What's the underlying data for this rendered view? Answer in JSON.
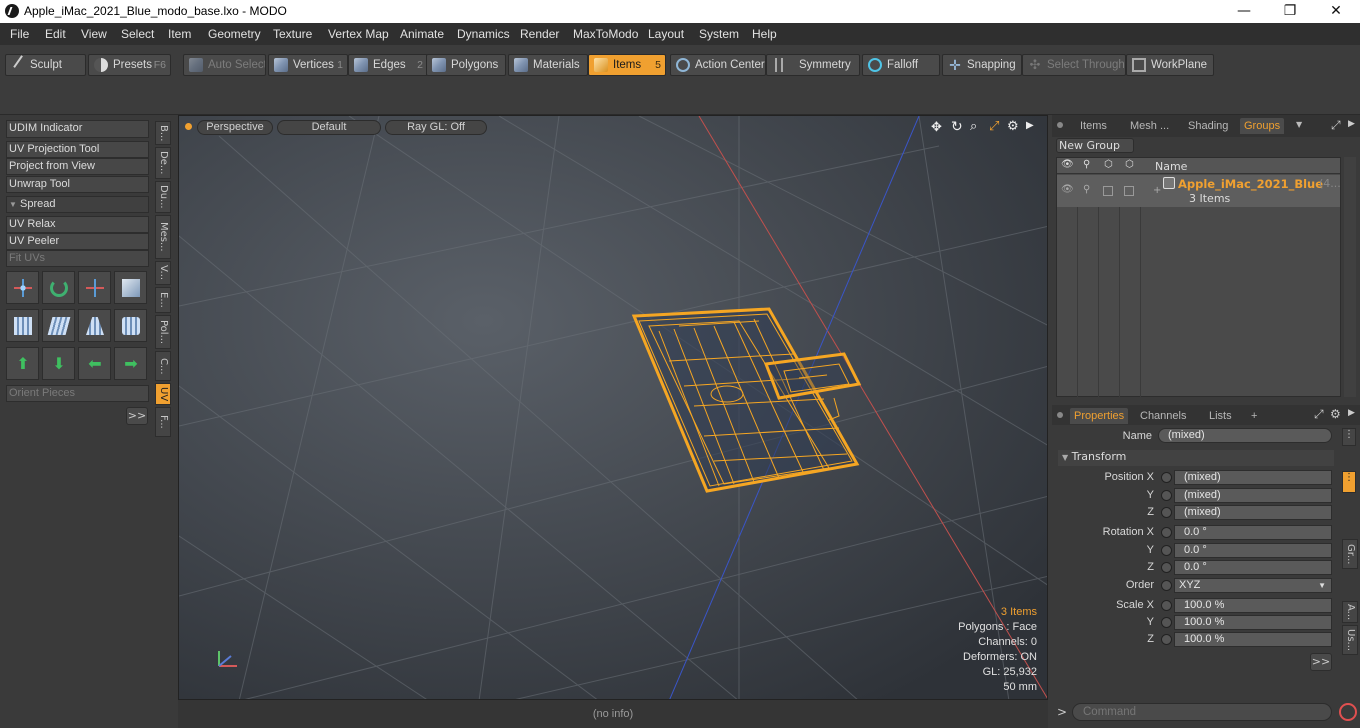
{
  "window": {
    "title": "Apple_iMac_2021_Blue_modo_base.lxo - MODO",
    "minimize": "—",
    "maximize": "❐",
    "close": "✕"
  },
  "menu": [
    "File",
    "Edit",
    "View",
    "Select",
    "Item",
    "Geometry",
    "Texture",
    "Vertex Map",
    "Animate",
    "Dynamics",
    "Render",
    "MaxToModo",
    "Layout",
    "System",
    "Help"
  ],
  "toolbar": {
    "sculpt": "Sculpt",
    "presets": "Presets",
    "presets_key": "F6",
    "auto_select": "Auto Select",
    "vertices": "Vertices",
    "vertices_key": "1",
    "edges": "Edges",
    "edges_key": "2",
    "polygons": "Polygons",
    "materials": "Materials",
    "items": "Items",
    "items_key": "5",
    "action_center": "Action Center",
    "symmetry": "Symmetry",
    "falloff": "Falloff",
    "snapping": "Snapping",
    "select_through": "Select Through",
    "workplane": "WorkPlane"
  },
  "left": {
    "udim": "UDIM Indicator",
    "uv_projection": "UV Projection Tool",
    "project_from_view": "Project from View",
    "unwrap": "Unwrap Tool",
    "spread": "Spread",
    "uv_relax": "UV Relax",
    "uv_peeler": "UV Peeler",
    "fit_uvs": "Fit UVs",
    "orient_pieces": "Orient Pieces",
    "more": ">>",
    "vtabs": [
      "B...",
      "De...",
      "Du...",
      "Mes...",
      "V...",
      "E...",
      "Pol...",
      "C...",
      "UV",
      "F..."
    ]
  },
  "viewport": {
    "perspective": "Perspective",
    "default": "Default",
    "raygl": "Ray GL: Off",
    "info_items": "3 Items",
    "info_polygons": "Polygons : Face",
    "info_channels": "Channels: 0",
    "info_deformers": "Deformers: ON",
    "info_gl": "GL: 25,932",
    "info_focal": "50 mm"
  },
  "status": {
    "text": "(no info)"
  },
  "items_panel": {
    "tabs": [
      "Items",
      "Mesh ...",
      "Shading",
      "Groups"
    ],
    "new_group": "New Group",
    "col_name": "Name",
    "group_name": "Apple_iMac_2021_Blue",
    "group_suffix": "(4...",
    "group_count": "3 Items"
  },
  "properties": {
    "tabs": [
      "Properties",
      "Channels",
      "Lists"
    ],
    "add_tab": "+",
    "name_label": "Name",
    "name_value": "(mixed)",
    "transform": "Transform",
    "position_x_label": "Position X",
    "y_label": "Y",
    "z_label": "Z",
    "pos_x": "(mixed)",
    "pos_y": "(mixed)",
    "pos_z": "(mixed)",
    "rotation_x_label": "Rotation X",
    "rot_x": "0.0 °",
    "rot_y": "0.0 °",
    "rot_z": "0.0 °",
    "order_label": "Order",
    "order_value": "XYZ",
    "scale_x_label": "Scale X",
    "scale_x": "100.0 %",
    "scale_y": "100.0 %",
    "scale_z": "100.0 %",
    "more": ">>",
    "side_tabs": [
      "Gr...",
      "A...",
      "Us..."
    ]
  },
  "command": {
    "prompt": ">",
    "placeholder": "Command"
  },
  "colors": {
    "accent": "#f0a030",
    "wireframe": "#f5a623",
    "axis_red": "#c0504d",
    "axis_blue": "#3a55c8"
  }
}
